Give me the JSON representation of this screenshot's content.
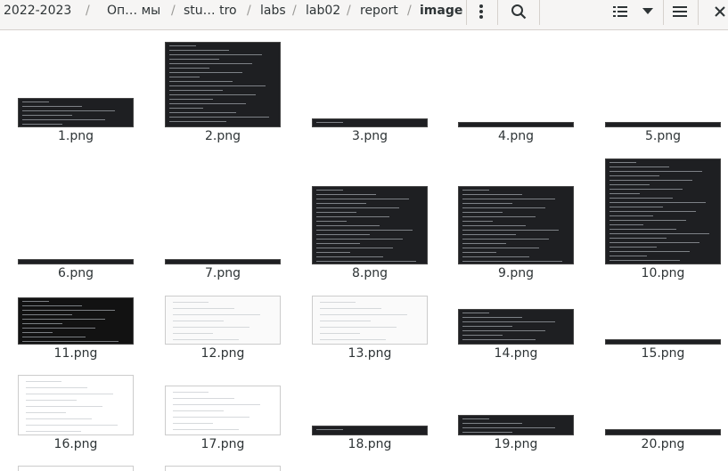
{
  "breadcrumb": {
    "segments": [
      "2022-2023",
      "Оп… мы",
      "stu… tro",
      "labs",
      "lab02",
      "report",
      "image"
    ]
  },
  "toolbar": {
    "menu_icon": "vertical-dots-icon",
    "search_icon": "search-icon",
    "view_icon": "list-view-icon",
    "view_options_icon": "chevron-down-icon",
    "hamburger_icon": "hamburger-menu-icon",
    "close_icon": "close-icon"
  },
  "files": [
    {
      "name": "1.png"
    },
    {
      "name": "2.png"
    },
    {
      "name": "3.png"
    },
    {
      "name": "4.png"
    },
    {
      "name": "5.png"
    },
    {
      "name": "6.png"
    },
    {
      "name": "7.png"
    },
    {
      "name": "8.png"
    },
    {
      "name": "9.png"
    },
    {
      "name": "10.png"
    },
    {
      "name": "11.png"
    },
    {
      "name": "12.png"
    },
    {
      "name": "13.png"
    },
    {
      "name": "14.png"
    },
    {
      "name": "15.png"
    },
    {
      "name": "16.png"
    },
    {
      "name": "17.png"
    },
    {
      "name": "18.png"
    },
    {
      "name": "19.png"
    },
    {
      "name": "20.png"
    }
  ],
  "colors": {
    "header_bg": "#f6f5f4",
    "terminal_bg": "#1e1f22",
    "github_green": "#2ea043"
  }
}
